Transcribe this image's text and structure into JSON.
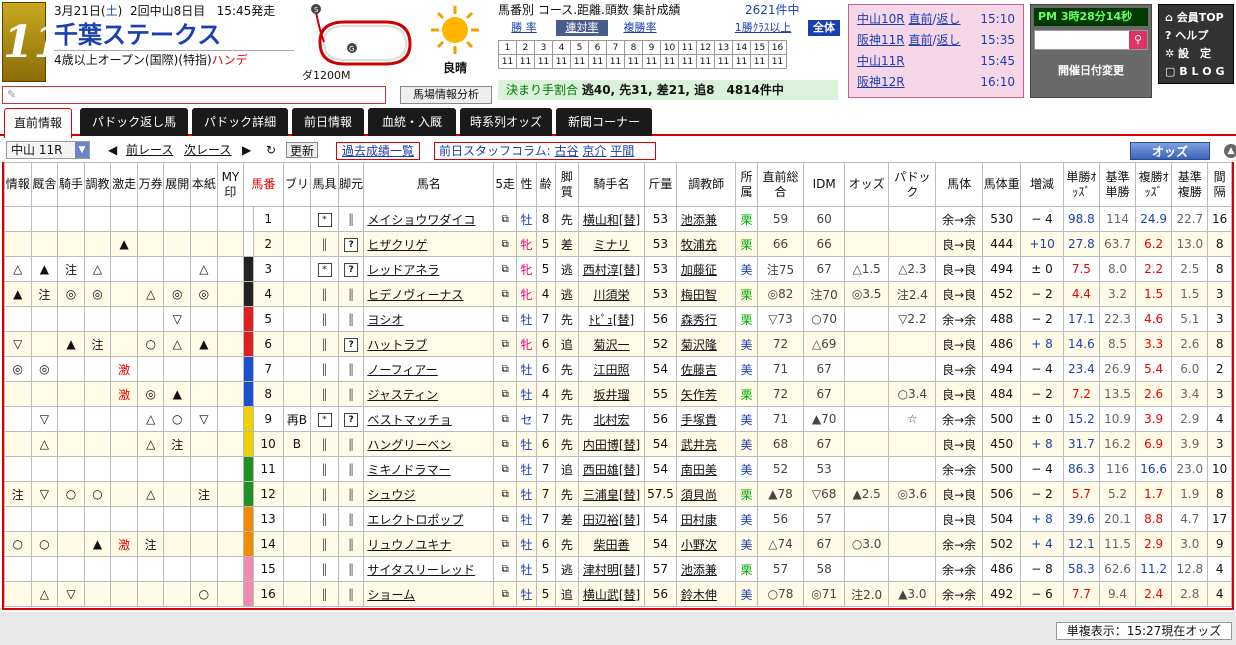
{
  "race": {
    "number": "11",
    "date_prefix": "3月21日(",
    "weekday": "土",
    "date_suffix": ")",
    "meeting": "2回中山8日目",
    "post_time": "15:45発走",
    "title": "千葉ステークス",
    "cond_prefix": "4歳以上オープン(国際)(特指)",
    "cond_handicap": "ハンデ",
    "course": "ダ1200M",
    "weather": "良晴"
  },
  "memo": {
    "placeholder": ""
  },
  "baba_button": "馬場情報分析",
  "stats": {
    "title": "馬番別 コース.距離.頭数 集計成績",
    "count": "2621件中",
    "tabs": [
      "勝 率",
      "連対率",
      "複勝率",
      "1勝ｸﾗｽ以上",
      "全体"
    ],
    "row1": [
      "1",
      "2",
      "3",
      "4",
      "5",
      "6",
      "7",
      "8",
      "9",
      "10",
      "11",
      "12",
      "13",
      "14",
      "15",
      "16"
    ],
    "row2": [
      "11",
      "11",
      "11",
      "11",
      "11",
      "11",
      "11",
      "11",
      "11",
      "11",
      "11",
      "11",
      "11",
      "11",
      "11",
      "11"
    ]
  },
  "kimarite": {
    "label": "決まり手割合",
    "value": "逃40, 先31, 差21, 追8　4814件中"
  },
  "other_races": [
    {
      "name": "中山10R",
      "link1": "直前",
      "link2": "返し",
      "time": "15:10"
    },
    {
      "name": "阪神11R",
      "link1": "直前",
      "link2": "返し",
      "time": "15:35"
    },
    {
      "name": "中山11R",
      "link1": "",
      "link2": "",
      "time": "15:45"
    },
    {
      "name": "阪神12R",
      "link1": "",
      "link2": "",
      "time": "16:10"
    }
  ],
  "clock": "PM 3時28分14秒",
  "date_change": "開催日付変更",
  "side_links": [
    "会員TOP",
    "ヘルプ",
    "設　定",
    "B L O G"
  ],
  "tabs": [
    "直前情報",
    "パドック返し馬",
    "パドック詳細",
    "前日情報",
    "血統・入厩",
    "時系列オッズ",
    "新聞コーナー"
  ],
  "toolbar": {
    "race": "中山 11R",
    "prev": "前レース",
    "next": "次レース",
    "refresh": "更新",
    "kako": "過去成績一覧",
    "column_label": "前日スタッフコラム:",
    "column_names": [
      "古谷",
      "京介",
      "平間"
    ],
    "odds": "オッズ"
  },
  "headers": [
    "情報",
    "厩舎",
    "騎手",
    "調教",
    "激走",
    "万券",
    "展開",
    "本紙",
    "MY印",
    "馬番",
    "ブリ",
    "馬具",
    "脚元",
    "馬名",
    "5走",
    "性",
    "齢",
    "脚質",
    "騎手名",
    "斤量",
    "調教師",
    "所属",
    "直前総合",
    "IDM",
    "オッズ",
    "パドック",
    "馬体",
    "馬体重",
    "増減",
    "単勝ｵｯｽﾞ",
    "基準単勝",
    "複勝ｵｯｽﾞ",
    "基準複勝",
    "間隔"
  ],
  "waku_colors": [
    "#ffffff",
    "#ffffff",
    "#222222",
    "#222222",
    "#e02020",
    "#e02020",
    "#1a4fd0",
    "#1a4fd0",
    "#f0d000",
    "#f0d000",
    "#209020",
    "#209020",
    "#f08a00",
    "#f08a00",
    "#f08ab0",
    "#f08ab0"
  ],
  "horses": [
    {
      "m": [
        "",
        "",
        "",
        "",
        "",
        "",
        "",
        "",
        ""
      ],
      "no": "1",
      "bl": "",
      "gear": "*",
      "ashi": "‖",
      "name": "メイショウワダイコ",
      "sex": "牡",
      "age": "8",
      "kyaku": "先",
      "jockey": "横山和[替]",
      "kin": "53",
      "trainer": "池添兼",
      "shozoku": "栗",
      "sogo": "59",
      "idm": "60",
      "odds_m": "",
      "pad": "",
      "taikei": "余→余",
      "weight": "530",
      "diff": "− 4",
      "tan": "98.8",
      "ktan": "114",
      "fuku": "24.9",
      "kfuku": "22.7",
      "kan": "16"
    },
    {
      "m": [
        "",
        "",
        "",
        "",
        "▲",
        "",
        "",
        "",
        ""
      ],
      "no": "2",
      "bl": "",
      "gear": "‖",
      "ashi": "?",
      "name": "ヒザクリゲ",
      "sex": "牝",
      "age": "5",
      "kyaku": "差",
      "jockey": "ミナリ",
      "kin": "53",
      "trainer": "牧浦充",
      "shozoku": "栗",
      "sogo": "66",
      "idm": "66",
      "odds_m": "",
      "pad": "",
      "taikei": "良→良",
      "weight": "444",
      "diff": "+10",
      "tan": "27.8",
      "ktan": "63.7",
      "fuku": "6.2",
      "kfuku": "13.0",
      "kan": "8"
    },
    {
      "m": [
        "△",
        "▲",
        "注",
        "△",
        "",
        "",
        "",
        "△",
        ""
      ],
      "no": "3",
      "bl": "",
      "gear": "*",
      "ashi": "?",
      "name": "レッドアネラ",
      "sex": "牝",
      "age": "5",
      "kyaku": "逃",
      "jockey": "西村淳[替]",
      "kin": "53",
      "trainer": "加藤征",
      "shozoku": "美",
      "sogo": "注75",
      "idm": "67",
      "odds_m": "△1.5",
      "pad": "△2.3",
      "taikei": "良→良",
      "weight": "494",
      "diff": "± 0",
      "tan": "7.5",
      "ktan": "8.0",
      "fuku": "2.2",
      "kfuku": "2.5",
      "kan": "8"
    },
    {
      "m": [
        "▲",
        "注",
        "◎",
        "◎",
        "",
        "△",
        "◎",
        "◎",
        ""
      ],
      "no": "4",
      "bl": "",
      "gear": "‖",
      "ashi": "‖",
      "name": "ヒデノヴィーナス",
      "sex": "牝",
      "age": "4",
      "kyaku": "逃",
      "jockey": "川須栄",
      "kin": "53",
      "trainer": "梅田智",
      "shozoku": "栗",
      "sogo": "◎82",
      "idm": "注70",
      "odds_m": "◎3.5",
      "pad": "注2.4",
      "taikei": "良→良",
      "weight": "452",
      "diff": "− 2",
      "tan": "4.4",
      "ktan": "3.2",
      "fuku": "1.5",
      "kfuku": "1.5",
      "kan": "3"
    },
    {
      "m": [
        "",
        "",
        "",
        "",
        "",
        "",
        "▽",
        "",
        ""
      ],
      "no": "5",
      "bl": "",
      "gear": "‖",
      "ashi": "‖",
      "name": "ヨシオ",
      "sex": "牡",
      "age": "7",
      "kyaku": "先",
      "jockey": "ﾄﾋﾟｭ[替]",
      "kin": "56",
      "trainer": "森秀行",
      "shozoku": "栗",
      "sogo": "▽73",
      "idm": "○70",
      "odds_m": "",
      "pad": "▽2.2",
      "taikei": "余→余",
      "weight": "488",
      "diff": "− 2",
      "tan": "17.1",
      "ktan": "22.3",
      "fuku": "4.6",
      "kfuku": "5.1",
      "kan": "3"
    },
    {
      "m": [
        "▽",
        "",
        "▲",
        "注",
        "",
        "○",
        "△",
        "▲",
        ""
      ],
      "no": "6",
      "bl": "",
      "gear": "‖",
      "ashi": "?",
      "name": "ハットラブ",
      "sex": "牝",
      "age": "6",
      "kyaku": "追",
      "jockey": "菊沢一",
      "kin": "52",
      "trainer": "菊沢隆",
      "shozoku": "美",
      "sogo": "72",
      "idm": "△69",
      "odds_m": "",
      "pad": "",
      "taikei": "良→良",
      "weight": "486",
      "diff": "+ 8",
      "tan": "14.6",
      "ktan": "8.5",
      "fuku": "3.3",
      "kfuku": "2.6",
      "kan": "8"
    },
    {
      "m": [
        "◎",
        "◎",
        "",
        "",
        "激",
        "",
        "",
        "",
        ""
      ],
      "no": "7",
      "bl": "",
      "gear": "‖",
      "ashi": "‖",
      "name": "ノーフィアー",
      "sex": "牡",
      "age": "6",
      "kyaku": "先",
      "jockey": "江田照",
      "kin": "54",
      "trainer": "佐藤吉",
      "shozoku": "美",
      "sogo": "71",
      "idm": "67",
      "odds_m": "",
      "pad": "",
      "taikei": "良→余",
      "weight": "494",
      "diff": "− 4",
      "tan": "23.4",
      "ktan": "26.9",
      "fuku": "5.4",
      "kfuku": "6.0",
      "kan": "2"
    },
    {
      "m": [
        "",
        "",
        "",
        "",
        "激",
        "◎",
        "▲",
        "",
        ""
      ],
      "no": "8",
      "bl": "",
      "gear": "‖",
      "ashi": "‖",
      "name": "ジャスティン",
      "sex": "牡",
      "age": "4",
      "kyaku": "先",
      "jockey": "坂井瑠",
      "kin": "55",
      "trainer": "矢作芳",
      "shozoku": "栗",
      "sogo": "72",
      "idm": "67",
      "odds_m": "",
      "pad": "○3.4",
      "taikei": "良→良",
      "weight": "484",
      "diff": "− 2",
      "tan": "7.2",
      "ktan": "13.5",
      "fuku": "2.6",
      "kfuku": "3.4",
      "kan": "3"
    },
    {
      "m": [
        "",
        "▽",
        "",
        "",
        "",
        "△",
        "○",
        "▽",
        ""
      ],
      "no": "9",
      "bl": "再B",
      "gear": "*",
      "ashi": "?",
      "name": "ベストマッチョ",
      "sex": "セ",
      "age": "7",
      "kyaku": "先",
      "jockey": "北村宏",
      "kin": "56",
      "trainer": "手塚貴",
      "shozoku": "美",
      "sogo": "71",
      "idm": "▲70",
      "odds_m": "",
      "pad": "☆",
      "taikei": "余→余",
      "weight": "500",
      "diff": "± 0",
      "tan": "15.2",
      "ktan": "10.9",
      "fuku": "3.9",
      "kfuku": "2.9",
      "kan": "4"
    },
    {
      "m": [
        "",
        "△",
        "",
        "",
        "",
        "△",
        "注",
        "",
        ""
      ],
      "no": "10",
      "bl": "B",
      "gear": "‖",
      "ashi": "‖",
      "name": "ハングリーベン",
      "sex": "牡",
      "age": "6",
      "kyaku": "先",
      "jockey": "内田博[替]",
      "kin": "54",
      "trainer": "武井亮",
      "shozoku": "美",
      "sogo": "68",
      "idm": "67",
      "odds_m": "",
      "pad": "",
      "taikei": "良→良",
      "weight": "450",
      "diff": "+ 8",
      "tan": "31.7",
      "ktan": "16.2",
      "fuku": "6.9",
      "kfuku": "3.9",
      "kan": "3"
    },
    {
      "m": [
        "",
        "",
        "",
        "",
        "",
        "",
        "",
        "",
        ""
      ],
      "no": "11",
      "bl": "",
      "gear": "‖",
      "ashi": "‖",
      "name": "ミキノドラマー",
      "sex": "牡",
      "age": "7",
      "kyaku": "追",
      "jockey": "西田雄[替]",
      "kin": "54",
      "trainer": "南田美",
      "shozoku": "美",
      "sogo": "52",
      "idm": "53",
      "odds_m": "",
      "pad": "",
      "taikei": "余→余",
      "weight": "500",
      "diff": "− 4",
      "tan": "86.3",
      "ktan": "116",
      "fuku": "16.6",
      "kfuku": "23.0",
      "kan": "10"
    },
    {
      "m": [
        "注",
        "▽",
        "○",
        "○",
        "",
        "△",
        "",
        "注",
        ""
      ],
      "no": "12",
      "bl": "",
      "gear": "‖",
      "ashi": "‖",
      "name": "シュウジ",
      "sex": "牡",
      "age": "7",
      "kyaku": "先",
      "jockey": "三浦皇[替]",
      "kin": "57.5",
      "trainer": "須貝尚",
      "shozoku": "栗",
      "sogo": "▲78",
      "idm": "▽68",
      "odds_m": "▲2.5",
      "pad": "◎3.6",
      "taikei": "良→良",
      "weight": "506",
      "diff": "− 2",
      "tan": "5.7",
      "ktan": "5.2",
      "fuku": "1.7",
      "kfuku": "1.9",
      "kan": "8"
    },
    {
      "m": [
        "",
        "",
        "",
        "",
        "",
        "",
        "",
        "",
        ""
      ],
      "no": "13",
      "bl": "",
      "gear": "‖",
      "ashi": "‖",
      "name": "エレクトロポップ",
      "sex": "牡",
      "age": "7",
      "kyaku": "差",
      "jockey": "田辺裕[替]",
      "kin": "54",
      "trainer": "田村康",
      "shozoku": "美",
      "sogo": "56",
      "idm": "57",
      "odds_m": "",
      "pad": "",
      "taikei": "良→良",
      "weight": "504",
      "diff": "+ 8",
      "tan": "39.6",
      "ktan": "20.1",
      "fuku": "8.8",
      "kfuku": "4.7",
      "kan": "17"
    },
    {
      "m": [
        "○",
        "○",
        "",
        "▲",
        "激",
        "注",
        "",
        "",
        ""
      ],
      "no": "14",
      "bl": "",
      "gear": "‖",
      "ashi": "‖",
      "name": "リュウノユキナ",
      "sex": "牡",
      "age": "6",
      "kyaku": "先",
      "jockey": "柴田善",
      "kin": "54",
      "trainer": "小野次",
      "shozoku": "美",
      "sogo": "△74",
      "idm": "67",
      "odds_m": "○3.0",
      "pad": "",
      "taikei": "余→余",
      "weight": "502",
      "diff": "+ 4",
      "tan": "12.1",
      "ktan": "11.5",
      "fuku": "2.9",
      "kfuku": "3.0",
      "kan": "9"
    },
    {
      "m": [
        "",
        "",
        "",
        "",
        "",
        "",
        "",
        "",
        ""
      ],
      "no": "15",
      "bl": "",
      "gear": "‖",
      "ashi": "‖",
      "name": "サイタスリーレッド",
      "sex": "牡",
      "age": "5",
      "kyaku": "逃",
      "jockey": "津村明[替]",
      "kin": "57",
      "trainer": "池添兼",
      "shozoku": "栗",
      "sogo": "57",
      "idm": "58",
      "odds_m": "",
      "pad": "",
      "taikei": "余→余",
      "weight": "486",
      "diff": "− 8",
      "tan": "58.3",
      "ktan": "62.6",
      "fuku": "11.2",
      "kfuku": "12.8",
      "kan": "4"
    },
    {
      "m": [
        "",
        "△",
        "▽",
        "",
        "",
        "",
        "",
        "○",
        ""
      ],
      "no": "16",
      "bl": "",
      "gear": "‖",
      "ashi": "‖",
      "name": "ショーム",
      "sex": "牡",
      "age": "5",
      "kyaku": "追",
      "jockey": "横山武[替]",
      "kin": "56",
      "trainer": "鈴木伸",
      "shozoku": "美",
      "sogo": "○78",
      "idm": "◎71",
      "odds_m": "注2.0",
      "pad": "▲3.0",
      "taikei": "余→余",
      "weight": "492",
      "diff": "− 6",
      "tan": "7.7",
      "ktan": "9.4",
      "fuku": "2.4",
      "kfuku": "2.8",
      "kan": "4"
    }
  ],
  "footer": "単複表示：15:27現在オッズ"
}
